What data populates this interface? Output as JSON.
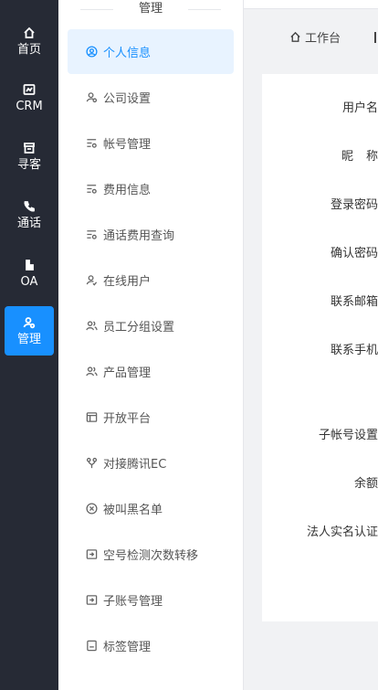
{
  "rail": {
    "items": [
      {
        "label": "首页",
        "icon": "home-icon"
      },
      {
        "label": "CRM",
        "icon": "crm-icon"
      },
      {
        "label": "寻客",
        "icon": "inbox-icon"
      },
      {
        "label": "通话",
        "icon": "phone-icon"
      },
      {
        "label": "OA",
        "icon": "oa-icon"
      },
      {
        "label": "管理",
        "icon": "user-gear-icon"
      }
    ],
    "active_color": "#1890ff",
    "background": "#262a35"
  },
  "submenu": {
    "title": "管理",
    "items": [
      {
        "label": "个人信息",
        "icon": "user-circle-icon"
      },
      {
        "label": "公司设置",
        "icon": "user-settings-icon"
      },
      {
        "label": "帐号管理",
        "icon": "list-settings-icon"
      },
      {
        "label": "费用信息",
        "icon": "list-settings-icon"
      },
      {
        "label": "通话费用查询",
        "icon": "list-settings-icon"
      },
      {
        "label": "在线用户",
        "icon": "user-check-icon"
      },
      {
        "label": "员工分组设置",
        "icon": "users-icon"
      },
      {
        "label": "产品管理",
        "icon": "users-icon"
      },
      {
        "label": "开放平台",
        "icon": "window-icon"
      },
      {
        "label": "对接腾讯EC",
        "icon": "connect-icon"
      },
      {
        "label": "被叫黑名单",
        "icon": "close-circle-icon"
      },
      {
        "label": "空号检测次数转移",
        "icon": "transfer-icon"
      },
      {
        "label": "子账号管理",
        "icon": "transfer-icon"
      },
      {
        "label": "标签管理",
        "icon": "tag-icon"
      }
    ]
  },
  "tabs": {
    "home": "工作台"
  },
  "form": {
    "labels": [
      "用户名",
      "昵称",
      "登录密码",
      "确认密码",
      "联系邮箱",
      "联系手机",
      "子帐号设置",
      "余额",
      "法人实名认证"
    ]
  }
}
